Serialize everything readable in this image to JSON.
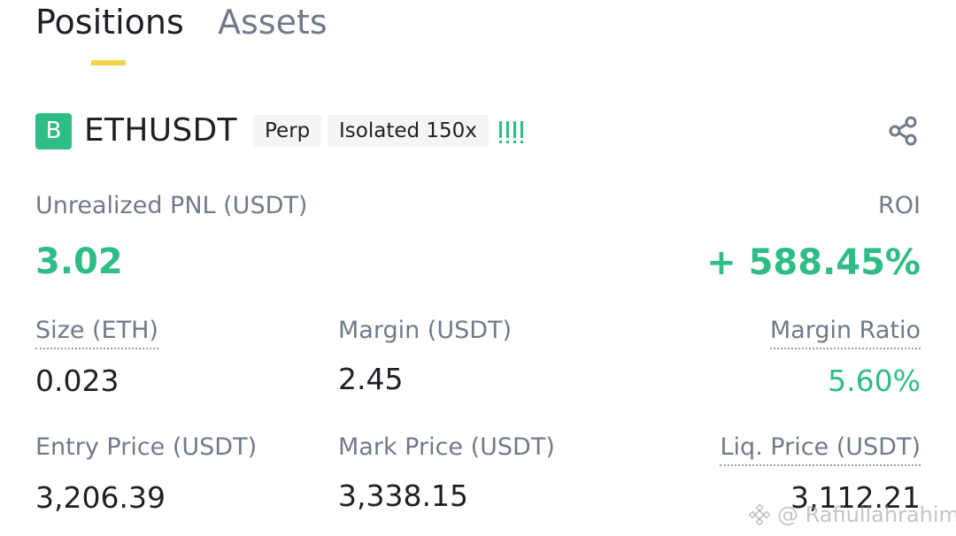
{
  "tabs": {
    "positions": "Positions",
    "assets": "Assets",
    "active_color": "#f0d547"
  },
  "position": {
    "side_badge": "B",
    "symbol": "ETHUSDT",
    "contract_type": "Perp",
    "margin_mode_leverage": "Isolated 150x",
    "leverage_indicator_icon": "signal-bars-icon",
    "share_icon": "share-icon"
  },
  "pnl": {
    "label": "Unrealized PNL (USDT)",
    "value": "3.02",
    "roi_label": "ROI",
    "roi_value": "+ 588.45%"
  },
  "details": {
    "size_label": "Size (ETH)",
    "size_value": "0.023",
    "margin_label": "Margin (USDT)",
    "margin_value": "2.45",
    "margin_ratio_label": "Margin Ratio",
    "margin_ratio_value": "5.60%",
    "entry_label": "Entry Price (USDT)",
    "entry_value": "3,206.39",
    "mark_label": "Mark Price (USDT)",
    "mark_value": "3,338.15",
    "liq_label": "Liq. Price (USDT)",
    "liq_value": "3,112.21"
  },
  "watermark": {
    "text": "@ Rafiullahrahimi"
  },
  "colors": {
    "positive": "#2ebd85",
    "text_primary": "#1e2026",
    "text_secondary": "#707a8a"
  }
}
